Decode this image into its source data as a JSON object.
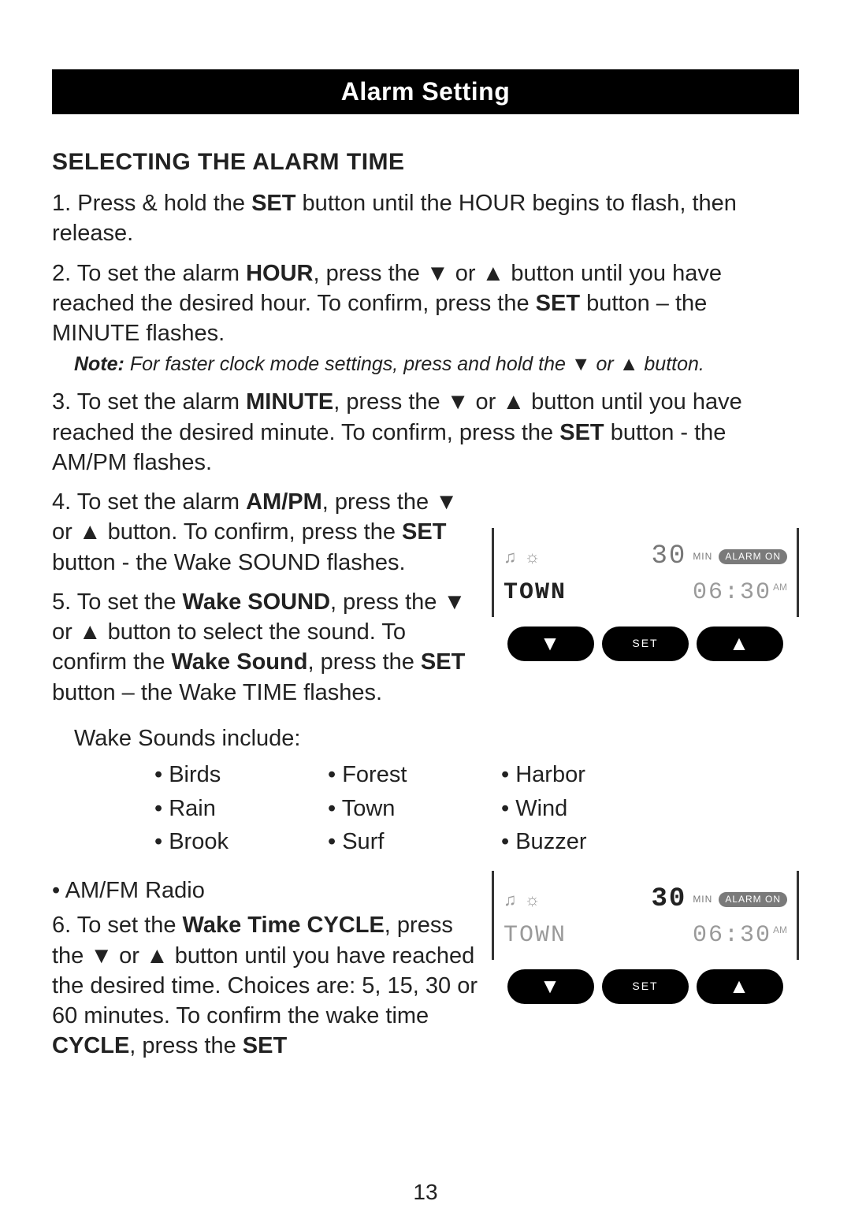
{
  "title_bar": "Alarm Setting",
  "heading": "SELECTING THE ALARM TIME",
  "steps": {
    "s1": {
      "num": "1.",
      "text_a": "Press & hold the ",
      "b1": "SET",
      "text_b": " button until the HOUR begins to flash, then release."
    },
    "s2": {
      "num": "2.",
      "text_a": "To set the alarm ",
      "b1": "HOUR",
      "text_b": ", press the ▼ or ▲ button until you have reached the desired hour. To confirm, press the ",
      "b2": "SET",
      "text_c": " button – the MINUTE flashes."
    },
    "s2_note": {
      "label": "Note:",
      "text": " For faster clock mode settings, press and hold the ▼ or ▲ button."
    },
    "s3": {
      "num": "3.",
      "text_a": "To set the alarm ",
      "b1": "MINUTE",
      "text_b": ", press the ▼ or ▲ button until you have reached the desired minute. To confirm, press the ",
      "b2": "SET",
      "text_c": " button - the AM/PM flashes."
    },
    "s4": {
      "num": "4.",
      "text_a": "To set the alarm ",
      "b1": "AM/PM",
      "text_b": ", press the ▼ or ▲ button. To confirm, press the ",
      "b2": "SET",
      "text_c": " button - the Wake SOUND flashes."
    },
    "s5": {
      "num": "5.",
      "text_a": "To set the ",
      "b1": "Wake SOUND",
      "text_b": ", press the ▼ or ▲ button to select the sound. To confirm the ",
      "b2": "Wake Sound",
      "text_c": ", press the ",
      "b3": "SET",
      "text_d": " button – the Wake TIME flashes."
    },
    "sounds_label": "Wake Sounds include:",
    "sounds": [
      "Birds",
      "Forest",
      "Harbor",
      "Rain",
      "Town",
      "Wind",
      "Brook",
      "Surf",
      "Buzzer"
    ],
    "radio": "• AM/FM Radio",
    "s6": {
      "num": "6.",
      "text_a": "To set the ",
      "b1": "Wake Time CYCLE",
      "text_b": ", press the ▼ or ▲ button until you have reached the desired time. Choices are: 5, 15, 30 or 60 minutes. To confirm the wake time ",
      "b2": "CYCLE",
      "text_c": ", press the ",
      "b3": "SET"
    }
  },
  "illus1": {
    "cycle": "30",
    "min": "MIN",
    "alarm_on": "ALARM ON",
    "sound": "TOWN",
    "time": "06:30",
    "ampm": "AM",
    "btn_down": "▼",
    "btn_set": "SET",
    "btn_up": "▲",
    "sound_bold": true,
    "cycle_bold": false
  },
  "illus2": {
    "cycle": "30",
    "min": "MIN",
    "alarm_on": "ALARM ON",
    "sound": "TOWN",
    "time": "06:30",
    "ampm": "AM",
    "btn_down": "▼",
    "btn_set": "SET",
    "btn_up": "▲",
    "sound_bold": false,
    "cycle_bold": true
  },
  "page_number": "13"
}
